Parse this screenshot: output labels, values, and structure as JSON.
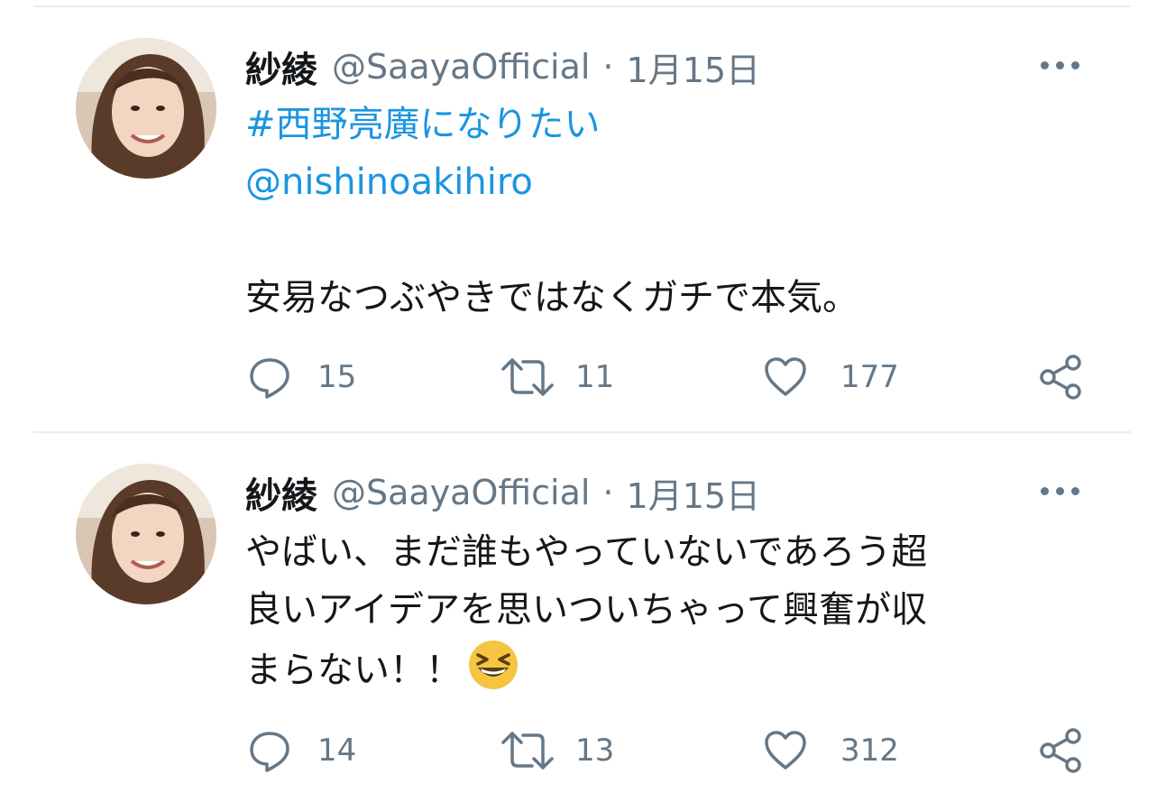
{
  "tweets": [
    {
      "author_name": "紗綾",
      "handle": "@SaayaOfficial",
      "separator": "·",
      "date": "1月15日",
      "hashtag": "#西野亮廣になりたい",
      "mention": "@nishinoakihiro",
      "text_lines": [
        "安易なつぶやきではなくガチで本気。"
      ],
      "actions": {
        "replies": "15",
        "retweets": "11",
        "likes": "177"
      }
    },
    {
      "author_name": "紗綾",
      "handle": "@SaayaOfficial",
      "separator": "·",
      "date": "1月15日",
      "text_lines": [
        "やばい、まだ誰もやっていないであろう超",
        "良いアイデアを思いついちゃって興奮が収",
        "まらない！！"
      ],
      "emoji": "grinning-squinting-face-emoji",
      "actions": {
        "replies": "14",
        "retweets": "13",
        "likes": "312"
      }
    }
  ],
  "colors": {
    "link": "#1b95e0",
    "muted": "#657786",
    "divider": "#e6ecf0"
  }
}
